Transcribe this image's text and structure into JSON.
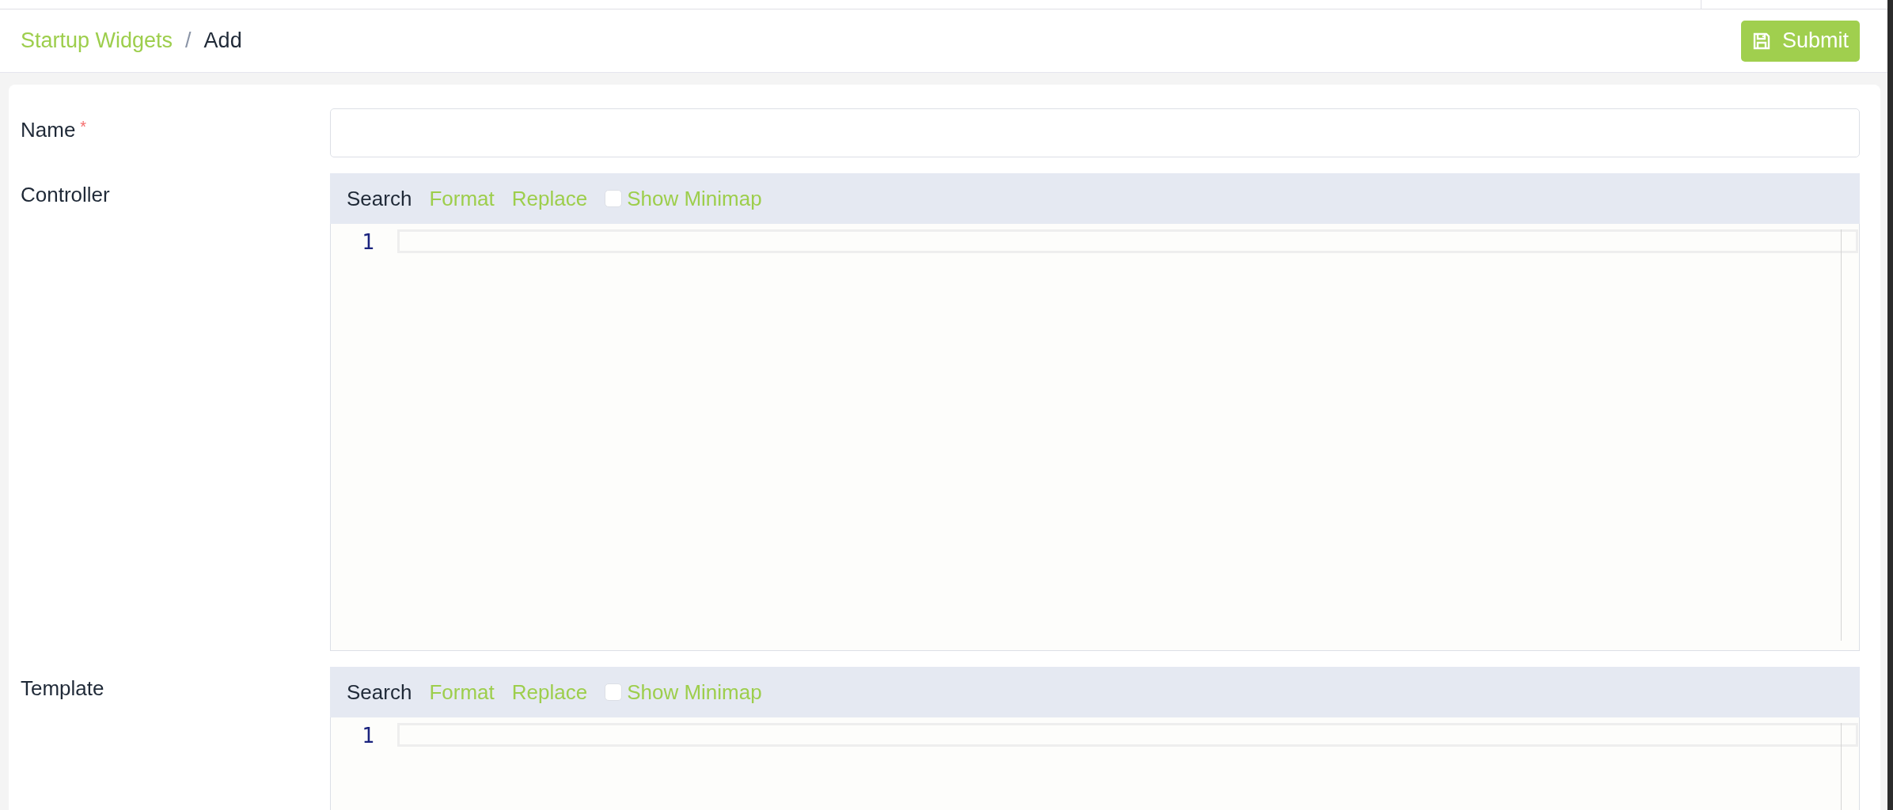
{
  "breadcrumb": [
    {
      "label": "Startup Widgets",
      "kind": "link"
    },
    {
      "label": "Add",
      "kind": "current"
    }
  ],
  "separator": "/",
  "required_mark": "*",
  "submit_button": {
    "label": "Submit"
  },
  "fields": [
    {
      "kind": "input",
      "label": "Name",
      "required": true
    },
    {
      "kind": "code_editor",
      "label": "Controller",
      "required": false,
      "toolbar": [
        {
          "label": "Search",
          "kind": "plain"
        },
        {
          "label": "Format",
          "kind": "link"
        },
        {
          "label": "Replace",
          "kind": "link"
        }
      ],
      "minimap": {
        "label": "Show Minimap",
        "checked": false
      },
      "line_numbers": [
        "1"
      ]
    },
    {
      "kind": "code_editor",
      "label": "Template",
      "required": false,
      "toolbar": [
        {
          "label": "Search",
          "kind": "plain"
        },
        {
          "label": "Format",
          "kind": "link"
        },
        {
          "label": "Replace",
          "kind": "link"
        }
      ],
      "minimap": {
        "label": "Show Minimap",
        "checked": false
      },
      "line_numbers": [
        "1"
      ]
    }
  ]
}
